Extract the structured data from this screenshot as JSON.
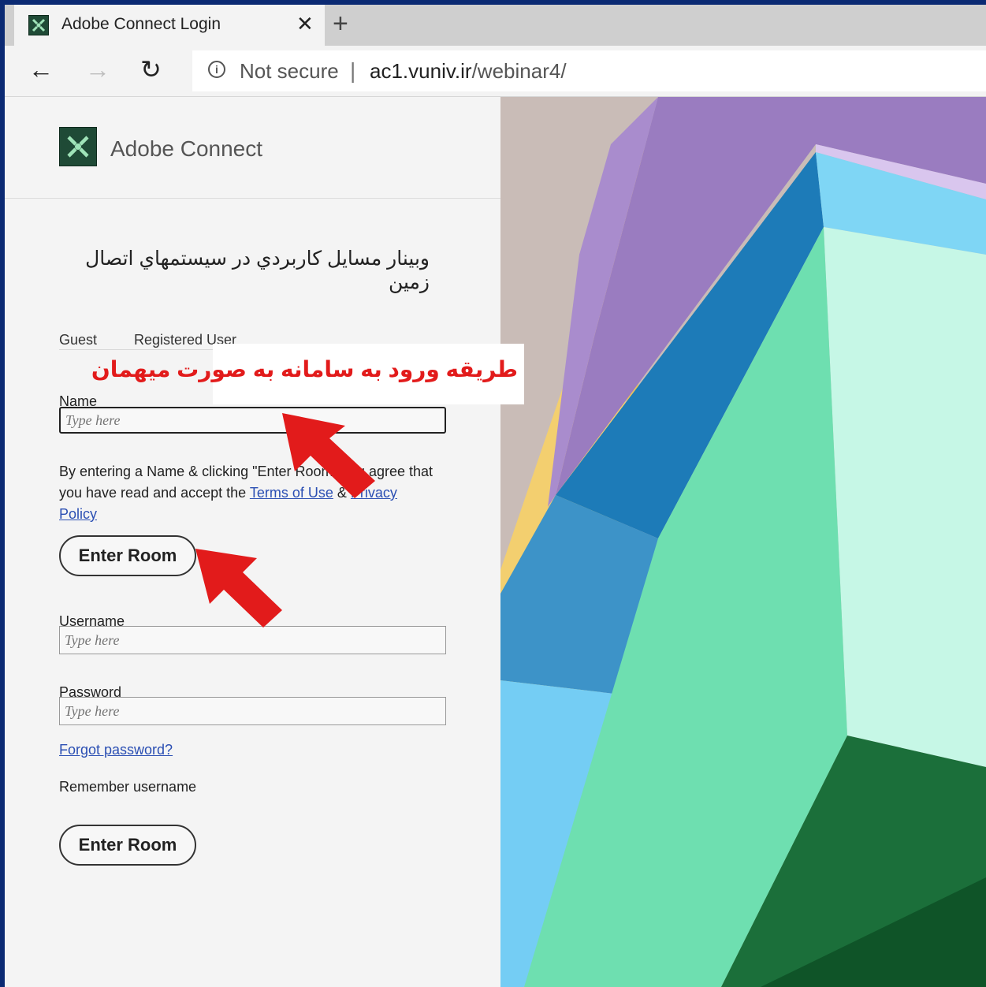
{
  "browser": {
    "tab_title": "Adobe Connect Login",
    "tab_close": "✕",
    "new_tab": "+",
    "back": "←",
    "forward": "→",
    "reload": "↻",
    "info_icon": "i",
    "not_secure": "Not secure",
    "separator": "|",
    "url_host": "ac1.vuniv.ir",
    "url_path": "/webinar4/"
  },
  "brand": {
    "name": "Adobe Connect"
  },
  "meeting": {
    "title": "وبينار مسايل كاربردي در سيستمهاي اتصال زمين"
  },
  "tabs": {
    "guest": "Guest",
    "registered": "Registered User"
  },
  "guest": {
    "name_label": "Name",
    "name_placeholder": "Type here",
    "agree_prefix": "By entering a Name & clicking \"Enter Room\" you agree that you have read and accept the ",
    "terms_link": "Terms of Use",
    "and": " & ",
    "privacy_link": "Privacy Policy",
    "enter_button": "Enter Room"
  },
  "registered": {
    "username_label": "Username",
    "username_placeholder": "Type here",
    "password_label": "Password",
    "password_placeholder": "Type here",
    "forgot_link": "Forgot password?",
    "remember_label": "Remember username",
    "enter_button": "Enter Room"
  },
  "annotation": {
    "callout_text": "طريقه ورود به سامانه به صورت ميهمان"
  },
  "colors": {
    "frame_border": "#0b2a73",
    "arrow_red": "#e21b1b",
    "logo_green": "#1f4a36",
    "link_blue": "#2b4fb3",
    "art_purple": "#9a7cc0",
    "art_mint": "#6edfb0",
    "art_blue": "#5db6e6",
    "art_yellow": "#f3cf6f",
    "art_dark_green": "#1b6f3a"
  }
}
